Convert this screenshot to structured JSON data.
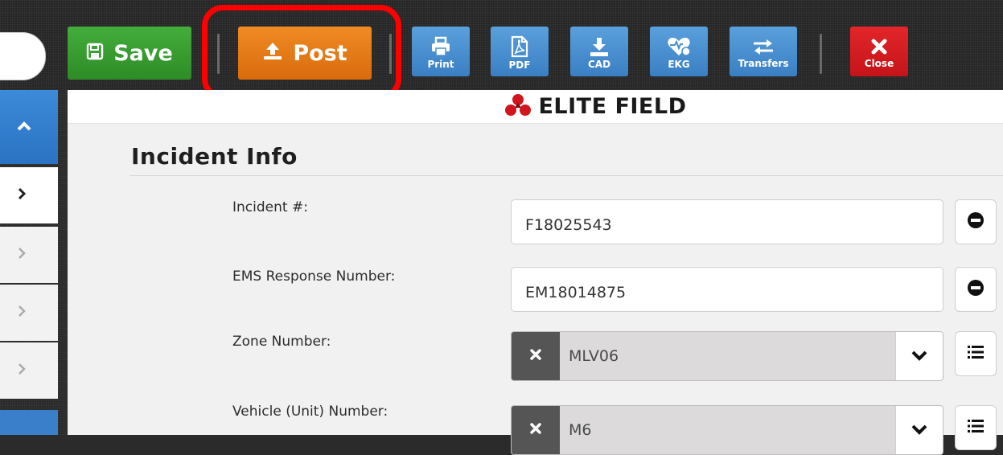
{
  "toolbar": {
    "save_label": "Save",
    "post_label": "Post",
    "print_label": "Print",
    "pdf_label": "PDF",
    "cad_label": "CAD",
    "ekg_label": "EKG",
    "transfers_label": "Transfers",
    "close_label": "Close"
  },
  "brand": {
    "name": "ELITE FIELD"
  },
  "section": {
    "title": "Incident Info"
  },
  "fields": {
    "incident_number": {
      "label": "Incident #:",
      "value": "F18025543"
    },
    "ems_response_number": {
      "label": "EMS Response Number:",
      "value": "EM18014875"
    },
    "zone_number": {
      "label": "Zone Number:",
      "value": "MLV06"
    },
    "vehicle_number": {
      "label": "Vehicle (Unit) Number:",
      "value": "M6"
    }
  },
  "colors": {
    "save": "#2e9b2a",
    "post": "#e57b16",
    "toolbar_blue": "#4a8fd0",
    "close_red": "#d21d22",
    "highlight": "#ff0000",
    "brand_red": "#d0151d"
  },
  "icons": {
    "save": "floppy-disk-icon",
    "post": "upload-icon",
    "print": "printer-icon",
    "pdf": "pdf-file-icon",
    "cad": "download-icon",
    "ekg": "heart-pulse-icon",
    "transfers": "transfer-arrows-icon",
    "close": "x-icon",
    "rail_up": "chevron-up-icon",
    "rail_right": "chevron-right-icon",
    "remove": "minus-circle-icon",
    "clear": "x-icon",
    "dropdown": "chevron-down-icon",
    "list": "list-icon"
  }
}
